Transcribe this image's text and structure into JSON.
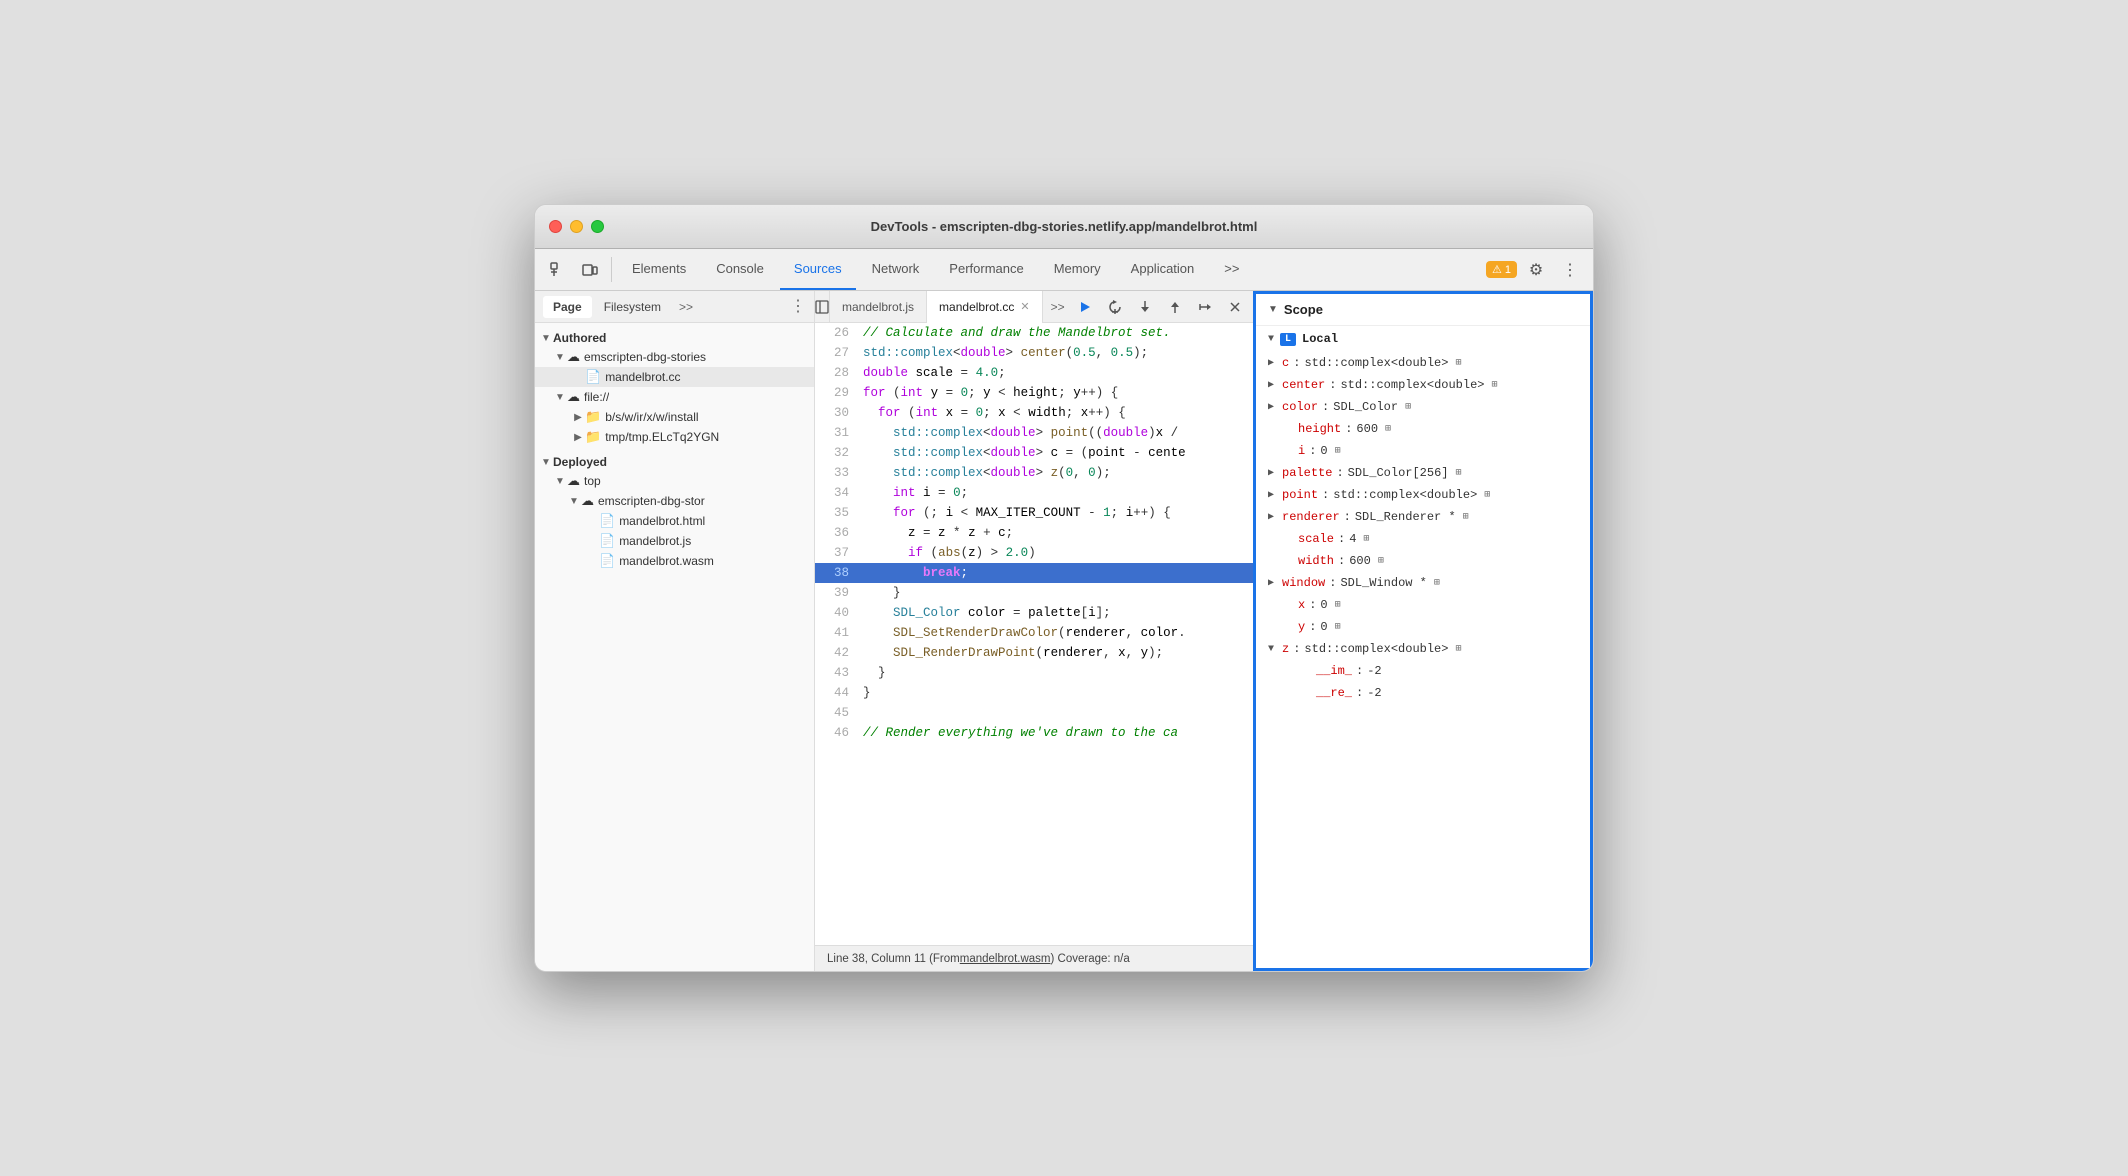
{
  "window": {
    "title": "DevTools - emscripten-dbg-stories.netlify.app/mandelbrot.html"
  },
  "toolbar": {
    "tabs": [
      {
        "label": "Elements",
        "active": false
      },
      {
        "label": "Console",
        "active": false
      },
      {
        "label": "Sources",
        "active": true
      },
      {
        "label": "Network",
        "active": false
      },
      {
        "label": "Performance",
        "active": false
      },
      {
        "label": "Memory",
        "active": false
      },
      {
        "label": "Application",
        "active": false
      },
      {
        "label": ">>",
        "active": false
      }
    ],
    "warning_count": "1"
  },
  "sidebar": {
    "tabs": [
      "Page",
      "Filesystem",
      ">>"
    ],
    "active_tab": "Page"
  },
  "file_tree": {
    "authored_label": "Authored",
    "deployed_label": "Deployed",
    "emscripten_url": "emscripten-dbg-stories",
    "emscripten_url2": "emscripten-dbg-stor",
    "file_cc": "mandelbrot.cc",
    "file_html": "mandelbrot.html",
    "file_js": "mandelbrot.js",
    "file_wasm": "mandelbrot.wasm",
    "folder_install": "b/s/w/ir/x/w/install",
    "folder_tmp": "tmp/tmp.ELcTq2YGN",
    "folder_top": "top",
    "file_url": "file://"
  },
  "code_tabs": {
    "tab1": "mandelbrot.js",
    "tab2": "mandelbrot.cc"
  },
  "code": {
    "lines": [
      {
        "num": "29",
        "content": ""
      },
      {
        "num": "26",
        "text": "// Calculate and draw the Mandelbrot set."
      },
      {
        "num": "27",
        "text": "std::complex<double> center(0.5, 0.5);"
      },
      {
        "num": "28",
        "text": "double scale = 4.0;"
      },
      {
        "num": "29",
        "text": "for (int y = 0; y < height; y++) {"
      },
      {
        "num": "30",
        "text": "  for (int x = 0; x < width; x++) {"
      },
      {
        "num": "31",
        "text": "    std::complex<double> point((double)x /"
      },
      {
        "num": "32",
        "text": "    std::complex<double> c = (point - cente"
      },
      {
        "num": "33",
        "text": "    std::complex<double> z(0, 0);"
      },
      {
        "num": "34",
        "text": "    int i = 0;"
      },
      {
        "num": "35",
        "text": "    for (; i < MAX_ITER_COUNT - 1; i++) {"
      },
      {
        "num": "36",
        "text": "      z = z * z + c;"
      },
      {
        "num": "37",
        "text": "      if (abs(z) > 2.0)"
      },
      {
        "num": "38",
        "text": "        break;",
        "highlighted": true
      },
      {
        "num": "39",
        "text": "    }"
      },
      {
        "num": "40",
        "text": "    SDL_Color color = palette[i];"
      },
      {
        "num": "41",
        "text": "    SDL_SetRenderDrawColor(renderer, color."
      },
      {
        "num": "42",
        "text": "    SDL_RenderDrawPoint(renderer, x, y);"
      },
      {
        "num": "43",
        "text": "  }"
      },
      {
        "num": "44",
        "text": "}"
      },
      {
        "num": "45",
        "text": ""
      },
      {
        "num": "46",
        "text": "// Render everything we've drawn to the ca"
      }
    ]
  },
  "status_bar": {
    "text": "Line 38, Column 11 (From ",
    "link": "mandelbrot.wasm",
    "text2": ") Coverage: n/a"
  },
  "scope": {
    "title": "Scope",
    "local_label": "Local",
    "items": [
      {
        "name": "c",
        "value": "std::complex<double>",
        "expandable": true
      },
      {
        "name": "center",
        "value": "std::complex<double>",
        "expandable": true
      },
      {
        "name": "color",
        "value": "SDL_Color",
        "expandable": true
      },
      {
        "name": "height",
        "value": "600",
        "expandable": false
      },
      {
        "name": "i",
        "value": "0",
        "expandable": false
      },
      {
        "name": "palette",
        "value": "SDL_Color[256]",
        "expandable": true
      },
      {
        "name": "point",
        "value": "std::complex<double>",
        "expandable": true
      },
      {
        "name": "renderer",
        "value": "SDL_Renderer *",
        "expandable": true
      },
      {
        "name": "scale",
        "value": "4",
        "expandable": false
      },
      {
        "name": "width",
        "value": "600",
        "expandable": false
      },
      {
        "name": "window",
        "value": "SDL_Window *",
        "expandable": true
      },
      {
        "name": "x",
        "value": "0",
        "expandable": false
      },
      {
        "name": "y",
        "value": "0",
        "expandable": false
      },
      {
        "name": "z",
        "value": "std::complex<double>",
        "expandable": true,
        "expanded": true
      },
      {
        "name": "__im_",
        "value": "-2",
        "sub": true
      },
      {
        "name": "__re_",
        "value": "-2",
        "sub": true
      }
    ]
  }
}
